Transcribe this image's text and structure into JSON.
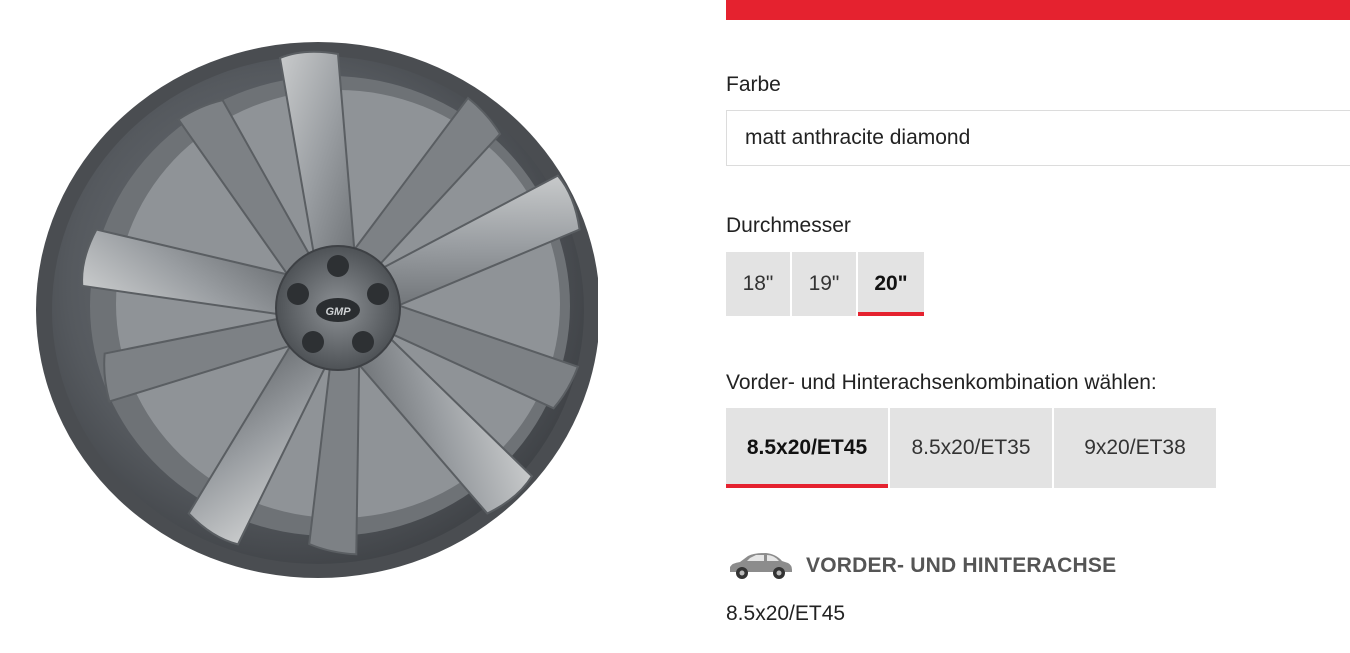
{
  "colors": {
    "accent": "#e5222f",
    "option_bg": "#e3e3e3",
    "border": "#dcdcdc"
  },
  "product_image": {
    "icon": "alloy-wheel-image",
    "hub_logo": "GMP"
  },
  "color_section": {
    "label": "Farbe",
    "selected_value": "matt anthracite diamond"
  },
  "diameter_section": {
    "label": "Durchmesser",
    "options": [
      {
        "label": "18\"",
        "selected": false
      },
      {
        "label": "19\"",
        "selected": false
      },
      {
        "label": "20\"",
        "selected": true
      }
    ]
  },
  "combination_section": {
    "label": "Vorder- und Hinterachsenkombination wählen:",
    "options": [
      {
        "label": "8.5x20/ET45",
        "selected": true
      },
      {
        "label": "8.5x20/ET35",
        "selected": false
      },
      {
        "label": "9x20/ET38",
        "selected": false
      }
    ]
  },
  "axle_section": {
    "icon": "car-icon",
    "title": "VORDER- UND HINTERACHSE",
    "value": "8.5x20/ET45"
  }
}
